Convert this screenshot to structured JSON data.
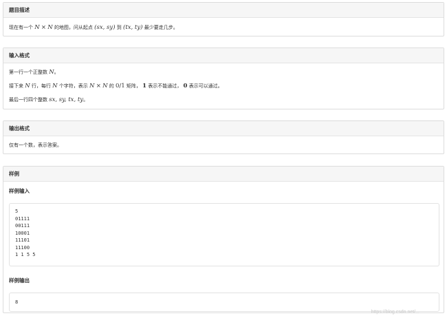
{
  "description": {
    "title": "题目描述",
    "text_before": "现在有一个",
    "n1": "N",
    "times": "×",
    "n2": "N",
    "text_mid": "的地图，问从起点",
    "start": "(sx, sy)",
    "to": "到",
    "end": "(tx, ty)",
    "text_after": "最少要走几步。"
  },
  "input_format": {
    "title": "输入格式",
    "line1_pre": "第一行一个正整数",
    "line1_var": "N",
    "line1_post": "。",
    "line2_pre": "接下来",
    "line2_var1": "N",
    "line2_mid1": "行，每行",
    "line2_var2": "N",
    "line2_mid2": "个字符，表示",
    "line2_var3": "N",
    "line2_times": "×",
    "line2_var4": "N",
    "line2_mid3": "的",
    "line2_frac": "0/1",
    "line2_mid4": "矩阵，",
    "line2_one": "1",
    "line2_mid5": "表示不能通过，",
    "line2_zero": "0",
    "line2_post": "表示可以通过。",
    "line3_pre": "最后一行四个整数",
    "line3_vars": "sx, sy, tx, ty",
    "line3_post": "。"
  },
  "output_format": {
    "title": "输出格式",
    "text": "仅有一个数，表示答案。"
  },
  "sample": {
    "title": "样例",
    "input_title": "样例输入",
    "input_lines": [
      "5",
      "01111",
      "00111",
      "10001",
      "11101",
      "11100",
      "1 1 5 5"
    ],
    "output_title": "样例输出",
    "output_lines": [
      "8"
    ]
  },
  "watermark": "https://blog.csdn.net/..."
}
